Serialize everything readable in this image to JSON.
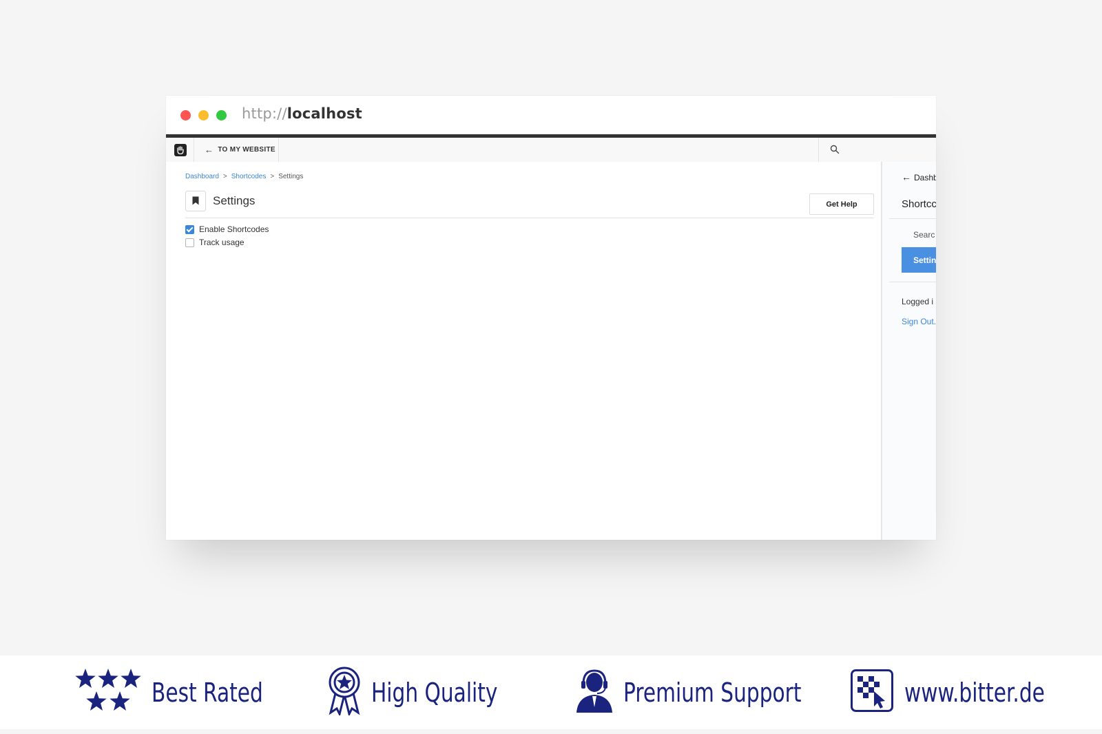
{
  "browser": {
    "url_protocol": "http://",
    "url_host": "localhost"
  },
  "toolbar": {
    "back_label": "TO MY WEBSITE"
  },
  "breadcrumb": {
    "items": [
      "Dashboard",
      "Shortcodes",
      "Settings"
    ],
    "separator": ">"
  },
  "page": {
    "title": "Settings",
    "help_button": "Get Help",
    "options": [
      {
        "label": "Enable Shortcodes",
        "checked": true
      },
      {
        "label": "Track usage",
        "checked": false
      }
    ]
  },
  "sidebar": {
    "back_label": "Dashb",
    "title": "Shortcc",
    "search_item": "Searc",
    "active_item": "Settin",
    "logged_in": "Logged i",
    "sign_out": "Sign Out."
  },
  "footer": {
    "badges": [
      "Best Rated",
      "High Quality",
      "Premium Support",
      "www.bitter.de"
    ]
  },
  "colors": {
    "accent": "#3a87d7",
    "footer_text": "#1a237e"
  }
}
